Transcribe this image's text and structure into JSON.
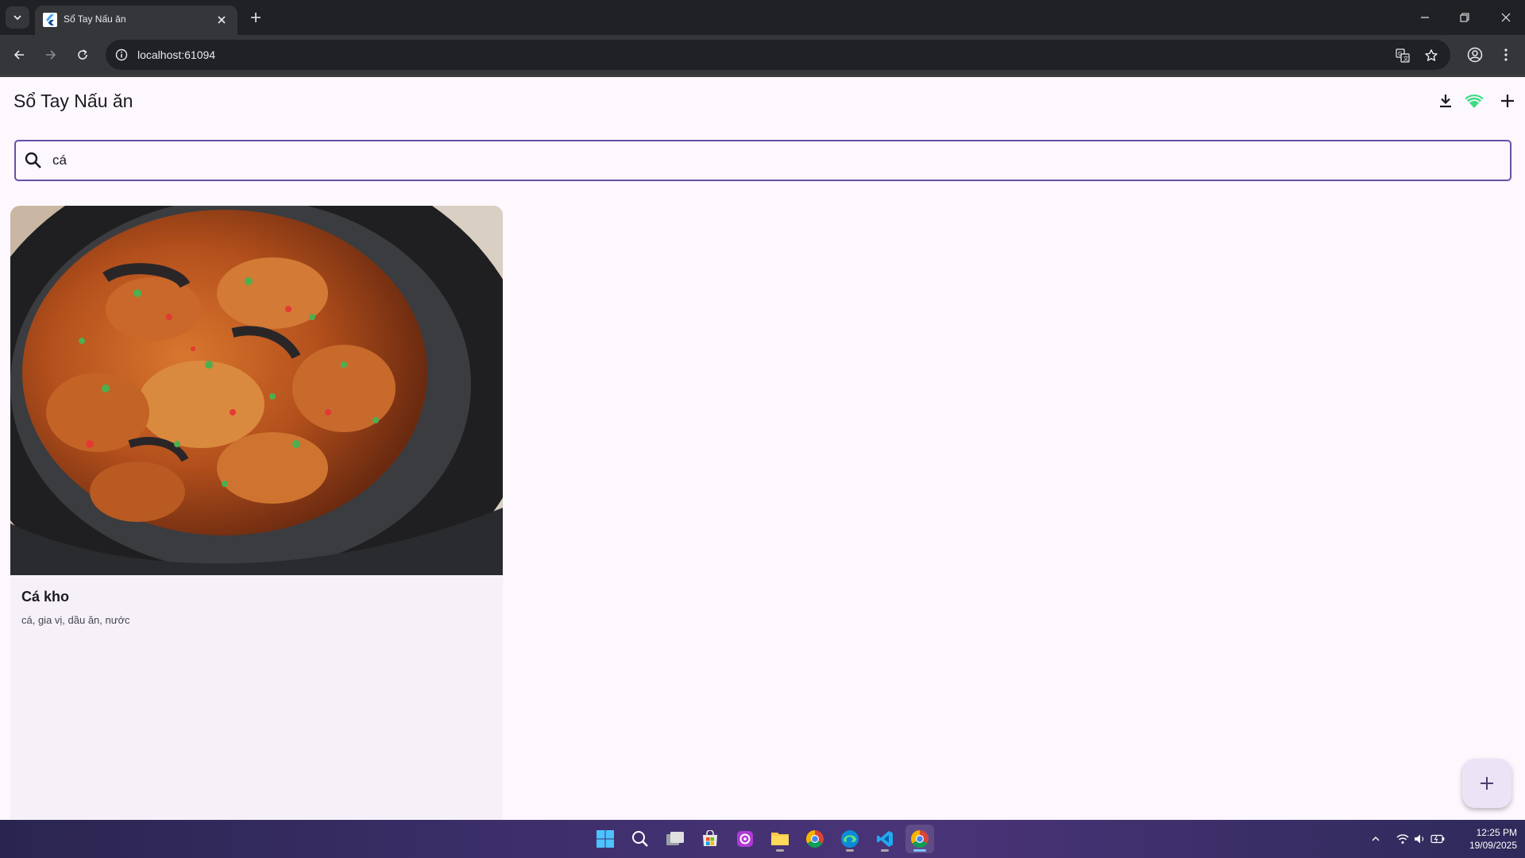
{
  "browser": {
    "tab_title": "Sổ Tay Nấu ăn",
    "url": "localhost:61094"
  },
  "app": {
    "title": "Sổ Tay Nấu ăn",
    "actions": [
      "download-icon",
      "wifi-icon",
      "add-icon"
    ]
  },
  "search": {
    "value": "cá",
    "icon": "search-icon"
  },
  "recipes": [
    {
      "title": "Cá kho",
      "ingredients": "cá, gia vị, dầu ăn, nước",
      "image": "braised fish in clay pot"
    }
  ],
  "fab": {
    "icon": "add-icon"
  },
  "taskbar": {
    "apps": [
      "windows-start-icon",
      "search-icon",
      "task-view-icon",
      "microsoft-store-icon",
      "media-app-icon",
      "file-explorer-icon",
      "chrome-icon",
      "edge-icon",
      "vscode-icon",
      "chrome-active-icon"
    ],
    "time": "12:25 PM",
    "date": "19/09/2025"
  },
  "colors": {
    "accent": "#6750a4",
    "background": "#fdf7fe",
    "card": "#f6f1f8",
    "wifi": "#3ddc84"
  }
}
